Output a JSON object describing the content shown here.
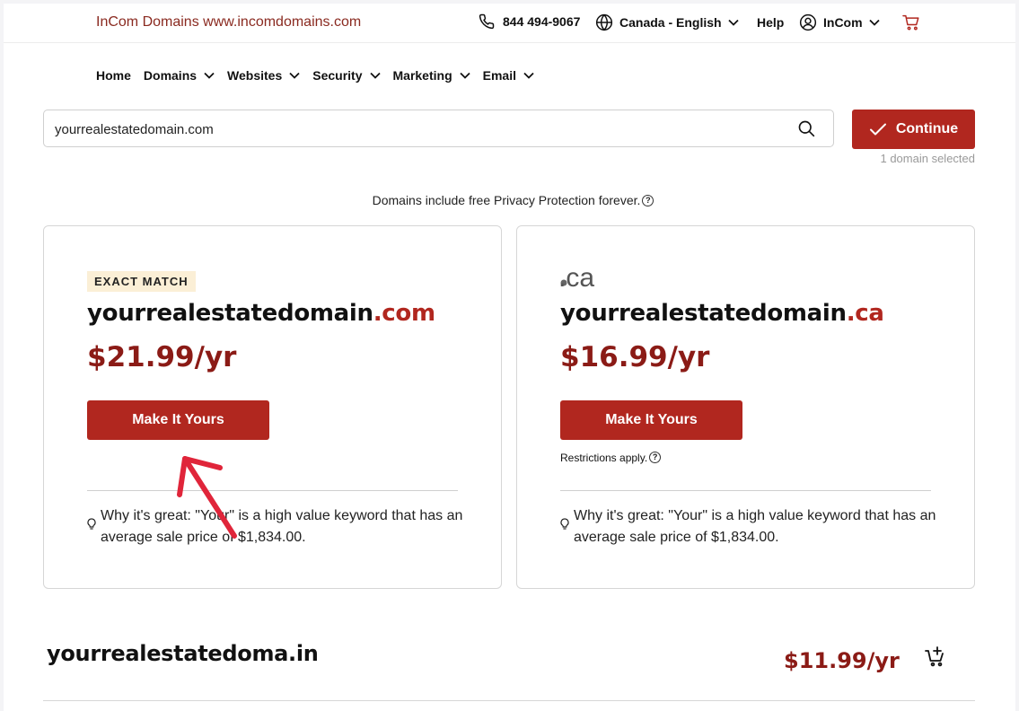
{
  "header": {
    "brand": "InCom Domains www.incomdomains.com",
    "phone": "844 494-9067",
    "region": "Canada - English",
    "help": "Help",
    "account": "InCom",
    "icons": [
      "phone-icon",
      "globe-icon",
      "user-icon",
      "cart-icon"
    ]
  },
  "nav": {
    "items": [
      {
        "label": "Home",
        "dropdown": false
      },
      {
        "label": "Domains",
        "dropdown": true
      },
      {
        "label": "Websites",
        "dropdown": true
      },
      {
        "label": "Security",
        "dropdown": true
      },
      {
        "label": "Marketing",
        "dropdown": true
      },
      {
        "label": "Email",
        "dropdown": true
      }
    ]
  },
  "search": {
    "value": "yourrealestatedomain.com",
    "placeholder": ""
  },
  "continue": {
    "label": "Continue",
    "selected_note": "1 domain selected"
  },
  "privacy_note": "Domains include free Privacy Protection forever.",
  "cards": [
    {
      "badge": "EXACT MATCH",
      "name": "yourrealestatedomain",
      "tld": ".com",
      "price": "$21.99/yr",
      "button": "Make It Yours",
      "why": "Why it's great: \"Your\" is a high value keyword that has an average sale price of $1,834.00."
    },
    {
      "tld_logo": ".ca",
      "name": "yourrealestatedomain",
      "tld": ".ca",
      "price": "$16.99/yr",
      "button": "Make It Yours",
      "restrictions": "Restrictions apply.",
      "why": "Why it's great: \"Your\" is a high value keyword that has an average sale price of $1,834.00."
    }
  ],
  "row": {
    "name": "yourrealestatedoma",
    "tld": ".in",
    "price": "$11.99/yr"
  },
  "colors": {
    "brand": "#8a2a20",
    "button": "#b1271f",
    "price": "#8b1b16",
    "badge_bg": "#fbefd6",
    "annotation_arrow": "#e0253a"
  }
}
